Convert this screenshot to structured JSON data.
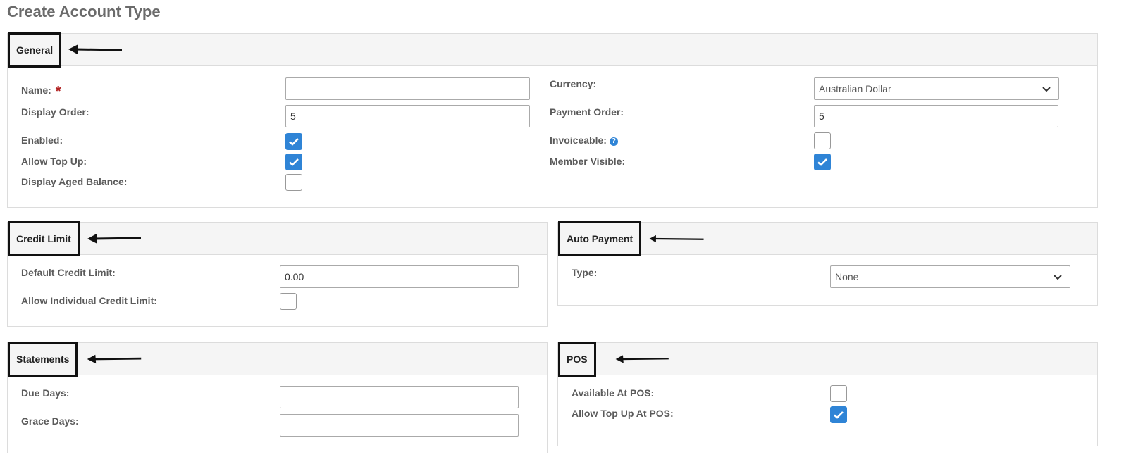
{
  "page": {
    "title": "Create Account Type"
  },
  "general": {
    "title": "General",
    "name_label": "Name:",
    "required_mark": "*",
    "name_value": "",
    "display_order_label": "Display Order:",
    "display_order_value": "5",
    "enabled_label": "Enabled:",
    "enabled_checked": true,
    "allow_top_up_label": "Allow Top Up:",
    "allow_top_up_checked": true,
    "display_aged_balance_label": "Display Aged Balance:",
    "display_aged_balance_checked": false,
    "currency_label": "Currency:",
    "currency_value": "Australian Dollar",
    "payment_order_label": "Payment Order:",
    "payment_order_value": "5",
    "invoiceable_label": "Invoiceable:",
    "invoiceable_help": "?",
    "invoiceable_checked": false,
    "member_visible_label": "Member Visible:",
    "member_visible_checked": true
  },
  "credit_limit": {
    "title": "Credit Limit",
    "default_credit_limit_label": "Default Credit Limit:",
    "default_credit_limit_value": "0.00",
    "allow_individual_label": "Allow Individual Credit Limit:",
    "allow_individual_checked": false
  },
  "auto_payment": {
    "title": "Auto Payment",
    "type_label": "Type:",
    "type_value": "None"
  },
  "statements": {
    "title": "Statements",
    "due_days_label": "Due Days:",
    "due_days_value": "",
    "grace_days_label": "Grace Days:",
    "grace_days_value": ""
  },
  "pos": {
    "title": "POS",
    "available_label": "Available At POS:",
    "available_checked": false,
    "allow_top_up_label": "Allow Top Up At POS:",
    "allow_top_up_checked": true
  },
  "colors": {
    "accent": "#2f84d6",
    "required": "#b22222",
    "header_bg": "#f5f5f5",
    "annotation": "#111111"
  },
  "icons": {
    "checkbox_check": "check-icon",
    "select_caret": "chevron-down-icon",
    "annotation_arrow": "arrow-left-icon",
    "help": "question-circle-icon"
  }
}
